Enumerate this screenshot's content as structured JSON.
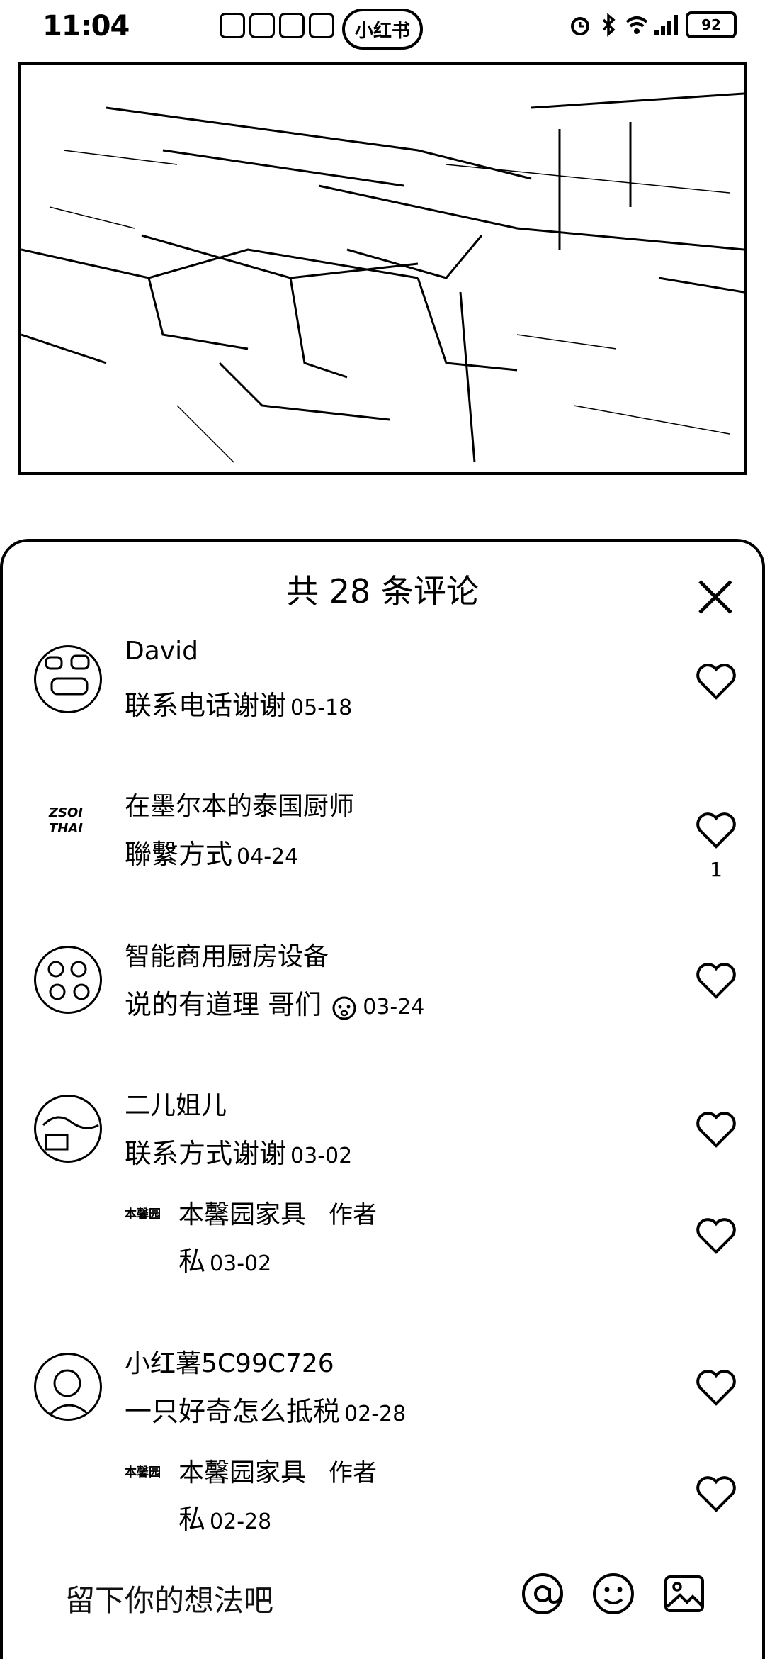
{
  "status_bar": {
    "time": "11:04",
    "app_label": "小红书",
    "battery": "92"
  },
  "sheet": {
    "title": "共 28 条评论"
  },
  "comments": [
    {
      "name": "David",
      "text": "联系电话谢谢",
      "date": "05-18",
      "like_count": ""
    },
    {
      "name": "在墨尔本的泰国厨师",
      "text": "聯繫方式",
      "date": "04-24",
      "like_count": "1",
      "avatar_text": "ZSOI THAI"
    },
    {
      "name": "智能商用厨房设备",
      "text": "说的有道理 哥们",
      "date": "03-24",
      "like_count": ""
    },
    {
      "name": "二儿姐儿",
      "text": "联系方式谢谢",
      "date": "03-02",
      "like_count": "",
      "reply": {
        "logo_text": "本馨园",
        "name": "本馨园家具",
        "tag": "作者",
        "text": "私",
        "date": "03-02"
      }
    },
    {
      "name": "小红薯5C99C726",
      "text": "一只好奇怎么抵税",
      "date": "02-28",
      "like_count": "",
      "reply": {
        "logo_text": "本馨园",
        "name": "本馨园家具",
        "tag": "作者",
        "text": "私",
        "date": "02-28"
      }
    }
  ],
  "input": {
    "placeholder": "留下你的想法吧"
  }
}
